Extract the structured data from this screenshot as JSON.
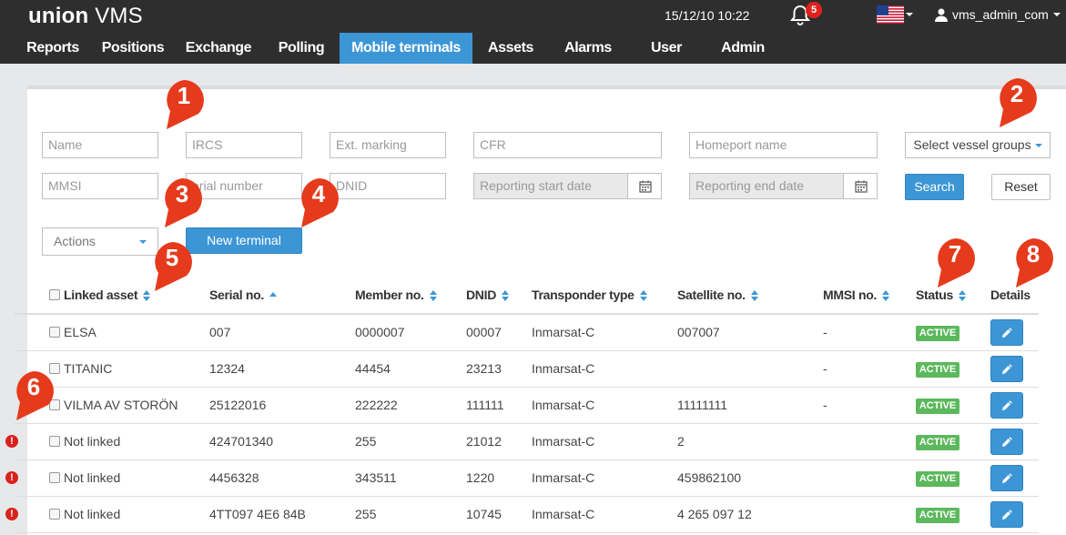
{
  "app": {
    "logo_bold": "union",
    "logo_light": "VMS",
    "datetime": "15/12/10 10:22",
    "notification_count": "5",
    "username": "vms_admin_com"
  },
  "nav": [
    {
      "label": "Reports",
      "active": false
    },
    {
      "label": "Positions",
      "active": false
    },
    {
      "label": "Exchange",
      "active": false
    },
    {
      "label": "Polling",
      "active": false
    },
    {
      "label": "Mobile terminals",
      "active": true
    },
    {
      "label": "Assets",
      "active": false
    },
    {
      "label": "Alarms",
      "active": false
    },
    {
      "label": "User",
      "active": false
    },
    {
      "label": "Admin",
      "active": false
    }
  ],
  "filters": {
    "name_placeholder": "Name",
    "ircs_placeholder": "IRCS",
    "ext_marking_placeholder": "Ext. marking",
    "cfr_placeholder": "CFR",
    "homeport_placeholder": "Homeport name",
    "vessel_groups_label": "Select vessel groups",
    "mmsi_placeholder": "MMSI",
    "serial_placeholder": "erial number",
    "dnid_placeholder": "DNID",
    "start_date_placeholder": "Reporting start date",
    "end_date_placeholder": "Reporting end date",
    "search_label": "Search",
    "reset_label": "Reset"
  },
  "toolbar": {
    "actions_label": "Actions",
    "new_terminal_label": "New terminal"
  },
  "table": {
    "headers": {
      "linked_asset": "Linked asset",
      "serial": "Serial no.",
      "member": "Member no.",
      "dnid": "DNID",
      "transponder": "Transponder type",
      "satellite": "Satellite no.",
      "mmsi": "MMSI no.",
      "status": "Status",
      "details": "Details"
    },
    "rows": [
      {
        "asset": "ELSA",
        "serial": "007",
        "member": "0000007",
        "dnid": "00007",
        "transponder": "Inmarsat-C",
        "satellite": "007007",
        "mmsi": "-",
        "status": "ACTIVE",
        "warn": false
      },
      {
        "asset": "TITANIC",
        "serial": "12324",
        "member": "44454",
        "dnid": "23213",
        "transponder": "Inmarsat-C",
        "satellite": "",
        "mmsi": "-",
        "status": "ACTIVE",
        "warn": false
      },
      {
        "asset": "VILMA AV STORÖN",
        "serial": "25122016",
        "member": "222222",
        "dnid": "111111",
        "transponder": "Inmarsat-C",
        "satellite": "11111111",
        "mmsi": "-",
        "status": "ACTIVE",
        "warn": false
      },
      {
        "asset": "Not linked",
        "serial": "424701340",
        "member": "255",
        "dnid": "21012",
        "transponder": "Inmarsat-C",
        "satellite": "2",
        "mmsi": "",
        "status": "ACTIVE",
        "warn": true
      },
      {
        "asset": "Not linked",
        "serial": "4456328",
        "member": "343511",
        "dnid": "1220",
        "transponder": "Inmarsat-C",
        "satellite": "459862100",
        "mmsi": "",
        "status": "ACTIVE",
        "warn": true
      },
      {
        "asset": "Not linked",
        "serial": "4TT097 4E6 84B",
        "member": "255",
        "dnid": "10745",
        "transponder": "Inmarsat-C",
        "satellite": "4 265 097 12",
        "mmsi": "",
        "status": "ACTIVE",
        "warn": true
      }
    ]
  },
  "callouts": [
    "1",
    "2",
    "3",
    "4",
    "5",
    "6",
    "7",
    "8"
  ],
  "colors": {
    "accent": "#3c96d6",
    "topbar": "#2e2e2e",
    "active_badge": "#5cb85c",
    "callout": "#e63a1c",
    "warning": "#d9221c"
  }
}
